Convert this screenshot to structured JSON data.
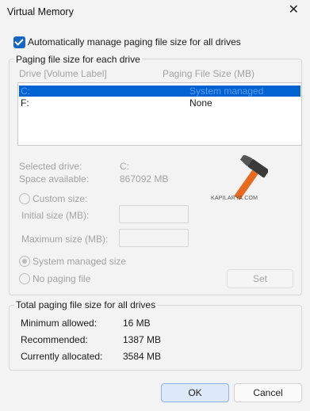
{
  "window": {
    "title": "Virtual Memory",
    "close_glyph": "✕"
  },
  "auto_manage": {
    "label": "Automatically manage paging file size for all drives",
    "checked": true
  },
  "paging_group": {
    "title": "Paging file size for each drive",
    "col_drive": "Drive  [Volume Label]",
    "col_size": "Paging File Size (MB)",
    "drives": [
      {
        "drive": "C:",
        "size": "System managed",
        "selected": true
      },
      {
        "drive": "F:",
        "size": "None",
        "selected": false
      }
    ],
    "selected_drive_label": "Selected drive:",
    "selected_drive_value": "C:",
    "space_available_label": "Space available:",
    "space_available_value": "867092 MB",
    "custom_size_label": "Custom size:",
    "initial_size_label": "Initial size (MB):",
    "initial_size_value": "",
    "maximum_size_label": "Maximum size (MB):",
    "maximum_size_value": "",
    "system_managed_label": "System managed size",
    "no_paging_label": "No paging file",
    "set_label": "Set",
    "selected_option": "system_managed",
    "watermark_text": "KAPILARYA.COM"
  },
  "total_group": {
    "title": "Total paging file size for all drives",
    "min_label": "Minimum allowed:",
    "min_value": "16 MB",
    "recommended_label": "Recommended:",
    "recommended_value": "1387 MB",
    "allocated_label": "Currently allocated:",
    "allocated_value": "3584 MB"
  },
  "buttons": {
    "ok": "OK",
    "cancel": "Cancel"
  },
  "colors": {
    "accent": "#1766c2",
    "selection": "#0063d1",
    "disabled_text": "#a3a3a3"
  }
}
